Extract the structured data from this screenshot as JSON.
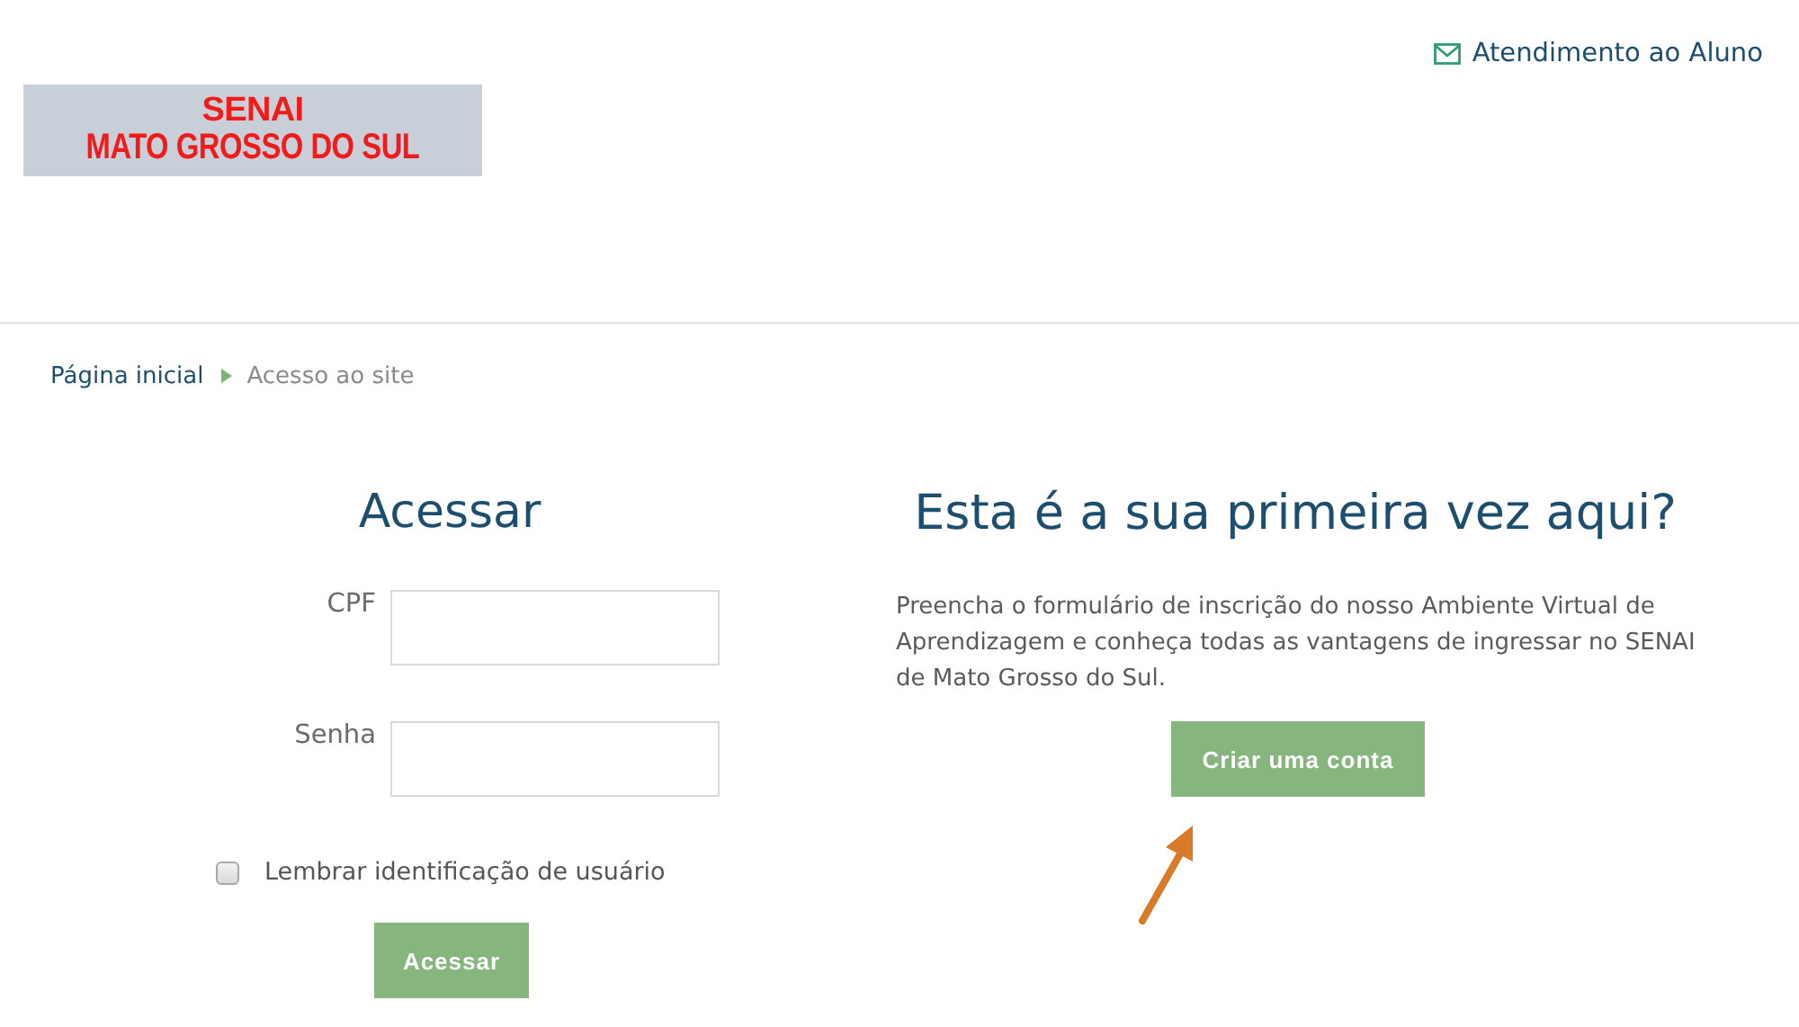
{
  "header": {
    "contact_link": "Atendimento ao Aluno",
    "logo": {
      "line_1": "SENAI",
      "line_2": "MATO GROSSO DO SUL"
    }
  },
  "breadcrumb": [
    "Página inicial",
    "Acesso ao site"
  ],
  "login": {
    "title": "Acessar",
    "fields": [
      {
        "label": "CPF"
      },
      {
        "label": "Senha"
      }
    ],
    "remember": {
      "label": "Lembrar identificação de usuário",
      "checked": false
    },
    "button": "Acessar"
  },
  "signup": {
    "title": "Esta é a sua primeira vez aqui?",
    "text": "Preencha o formulário de inscrição do nosso Ambiente Virtual de Aprendizagem e conheça todas as vantagens de ingressar no SENAI de Mato Grosso do Sul.",
    "button": "Criar uma conta"
  }
}
